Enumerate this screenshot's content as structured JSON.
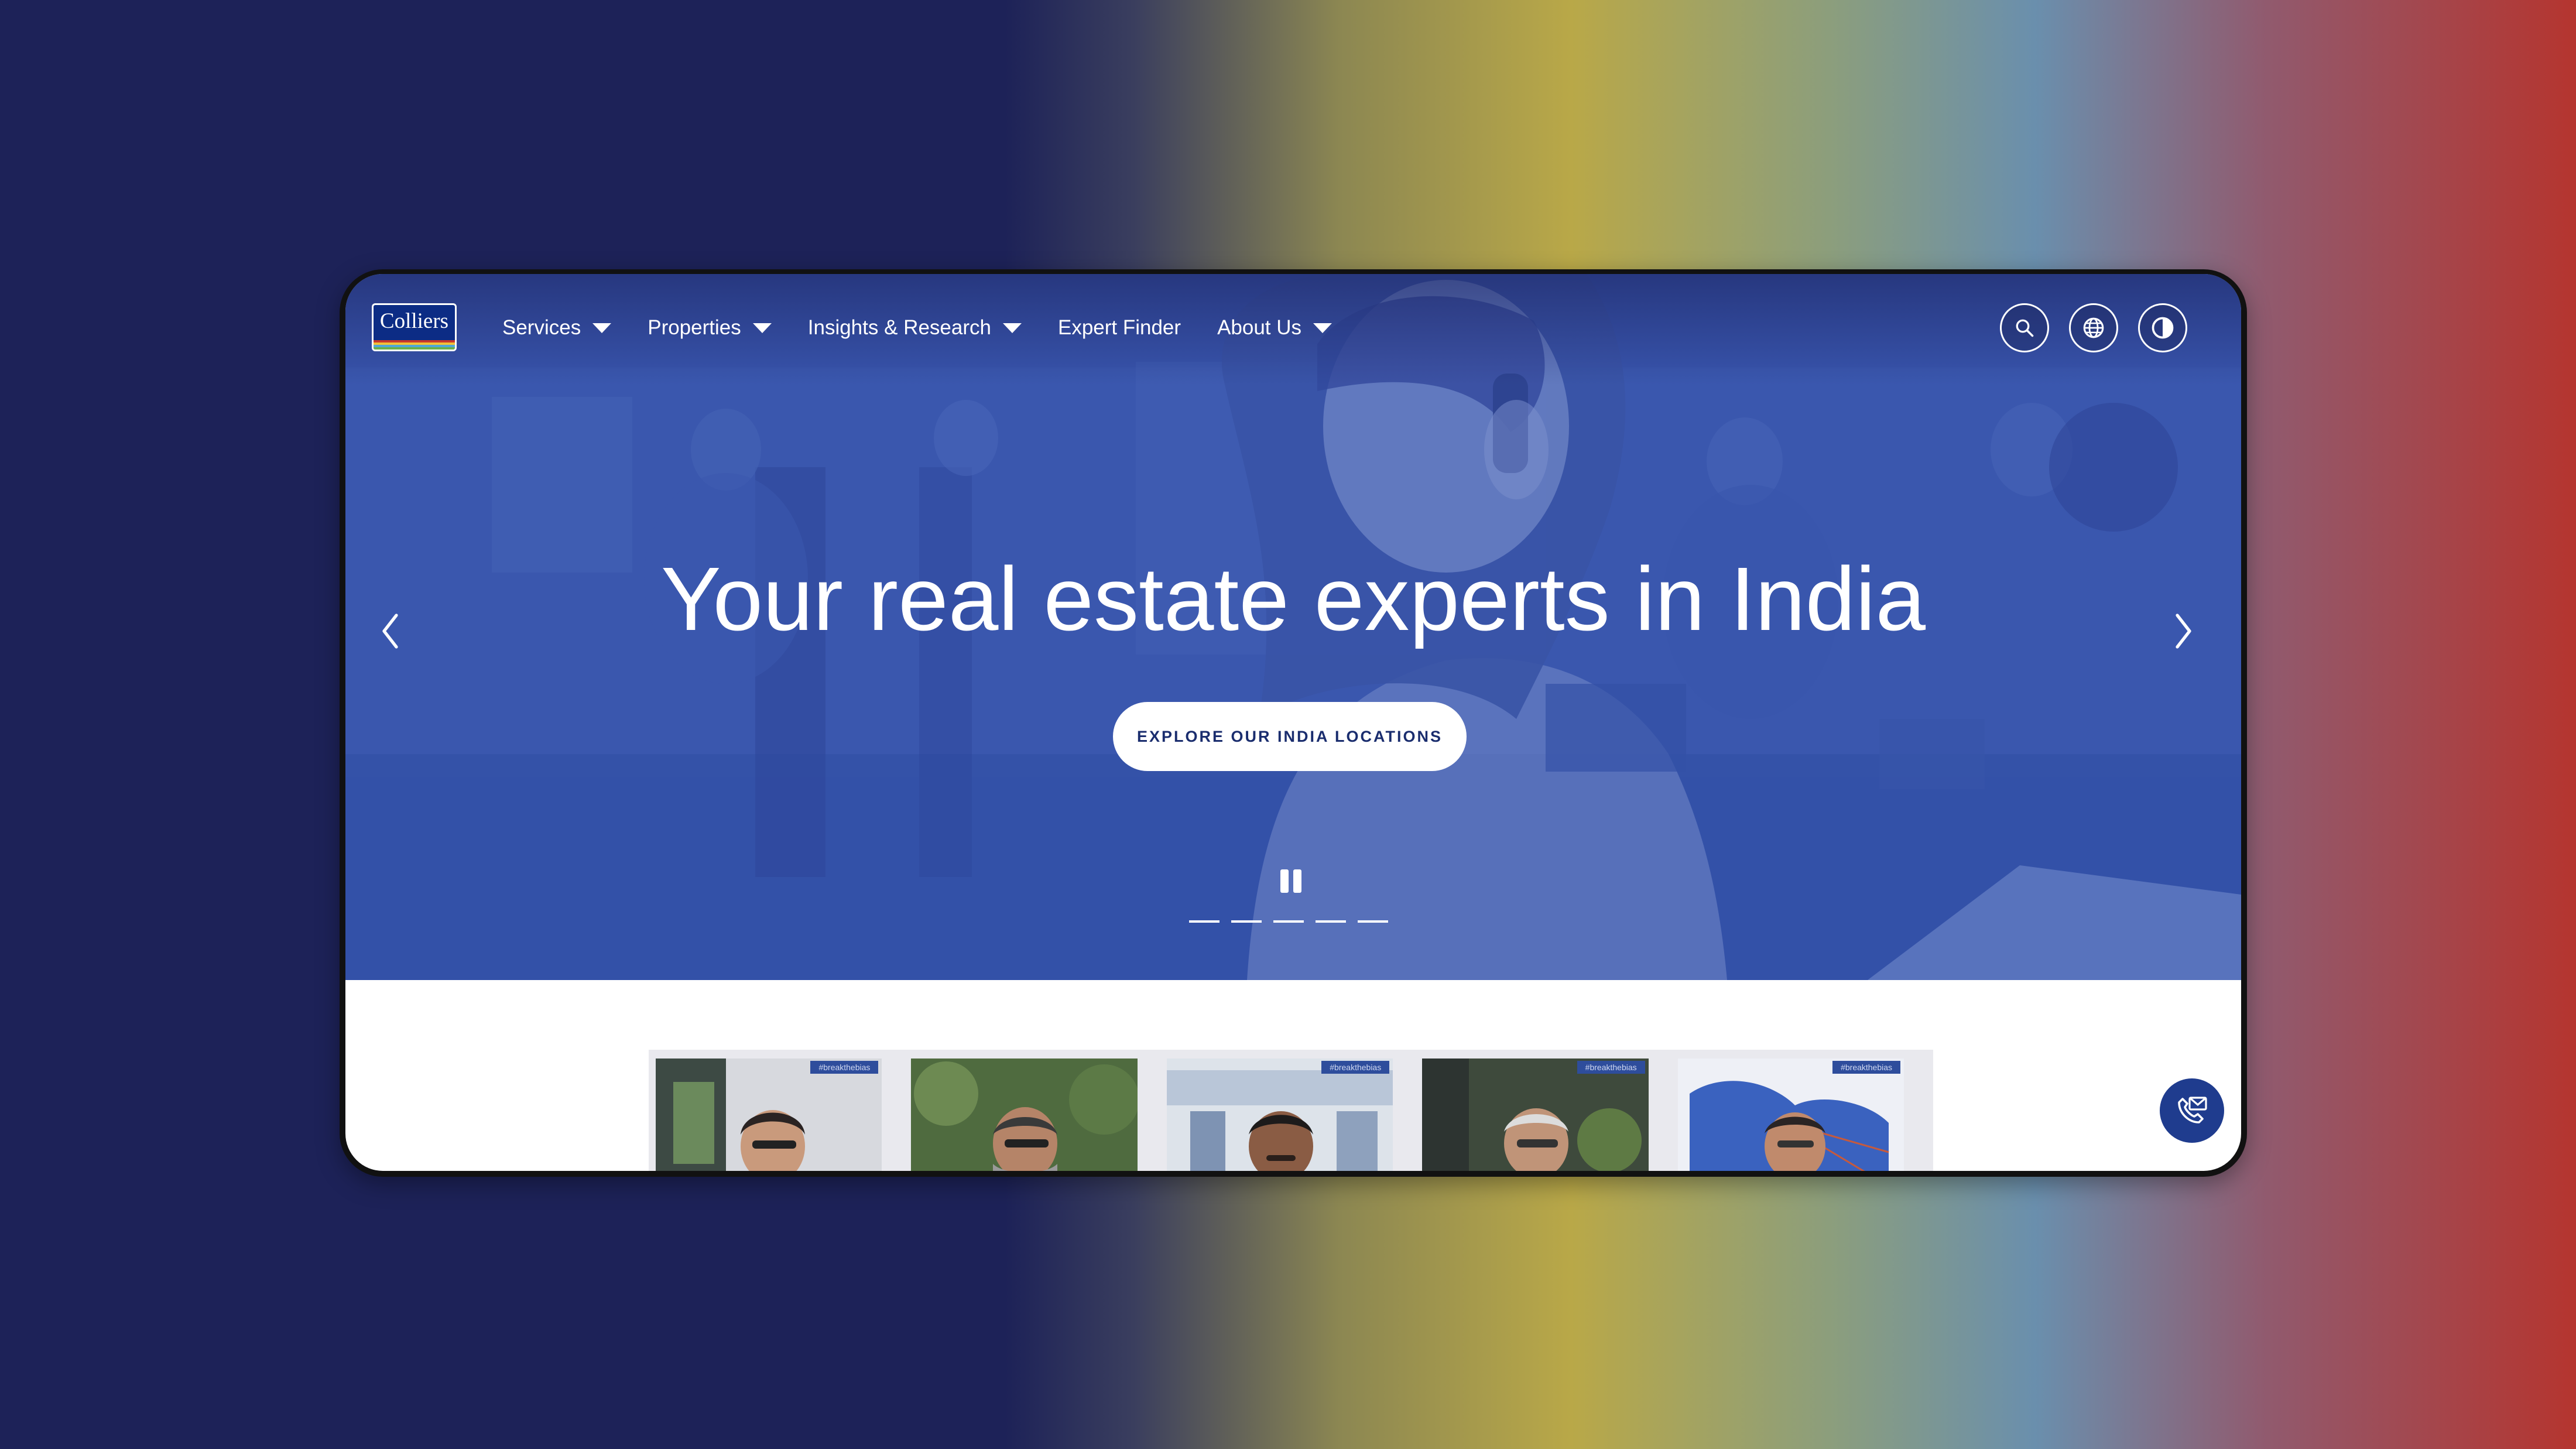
{
  "brand": {
    "logo_text": "Colliers",
    "colors": {
      "navy": "#0c2c85",
      "hero_blue": "#3a56ad",
      "stripe_colors": [
        "#c8372d",
        "#f2c038",
        "#4fa7d9",
        "#6bb04c"
      ]
    }
  },
  "nav": {
    "items": [
      {
        "label": "Services",
        "has_dropdown": true
      },
      {
        "label": "Properties",
        "has_dropdown": true
      },
      {
        "label": "Insights & Research",
        "has_dropdown": true
      },
      {
        "label": "Expert Finder",
        "has_dropdown": false
      },
      {
        "label": "About Us",
        "has_dropdown": true
      }
    ],
    "tools": [
      "search-icon",
      "globe-icon",
      "contrast-icon"
    ]
  },
  "hero": {
    "headline": "Your real estate experts in India",
    "cta_label": "EXPLORE OUR INDIA LOCATIONS",
    "slide_count": 5,
    "controls": [
      "chevron-left-icon",
      "chevron-right-icon",
      "pause-icon"
    ]
  },
  "strip": {
    "tag": "#breakthebias",
    "thumbnails": 5
  },
  "chat": {
    "icon": "phone-mail-icon"
  }
}
